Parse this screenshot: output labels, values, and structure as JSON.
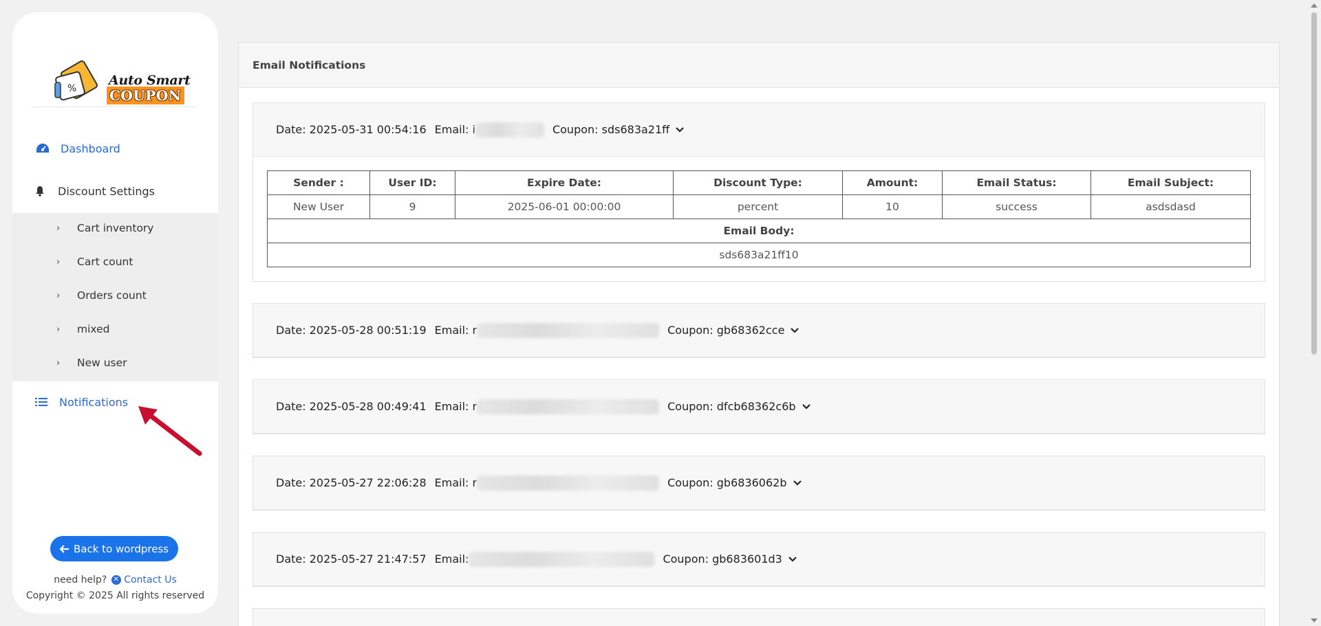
{
  "logo": {
    "line1": "Auto Smart",
    "line2": "COUPON"
  },
  "nav": {
    "dashboard": "Dashboard",
    "discount_settings": "Discount Settings",
    "submenu": [
      "Cart inventory",
      "Cart count",
      "Orders count",
      "mixed",
      "New user"
    ],
    "notifications": "Notifications"
  },
  "footer": {
    "back_button": "Back to wordpress",
    "need_help": "need help?",
    "contact_us": "Contact Us",
    "copyright": "Copyright © 2025 All rights reserved"
  },
  "main": {
    "title": "Email Notifications",
    "notifications": [
      {
        "date": "Date: 2025-05-31 00:54:16",
        "email_label": "Email: i",
        "coupon": "Coupon: sds683a21ff"
      },
      {
        "date": "Date: 2025-05-28 00:51:19",
        "email_label": "Email: r",
        "coupon": "Coupon: gb68362cce"
      },
      {
        "date": "Date: 2025-05-28 00:49:41",
        "email_label": "Email: r",
        "coupon": "Coupon: dfcb68362c6b"
      },
      {
        "date": "Date: 2025-05-27 22:06:28",
        "email_label": "Email: r",
        "coupon": "Coupon: gb6836062b"
      },
      {
        "date": "Date: 2025-05-27 21:47:57",
        "email_label": "Email: ",
        "coupon": "Coupon: gb683601d3"
      }
    ],
    "details": {
      "headers": [
        "Sender :",
        "User ID:",
        "Expire Date:",
        "Discount Type:",
        "Amount:",
        "Email Status:",
        "Email Subject:"
      ],
      "row": [
        "New User",
        "9",
        "2025-06-01 00:00:00",
        "percent",
        "10",
        "success",
        "asdsdasd"
      ],
      "body_label": "Email Body:",
      "body_value": "sds683a21ff10"
    }
  },
  "colors": {
    "accent": "#2b6ad6",
    "button": "#1a73e8",
    "arrow": "#c8102e",
    "logo_orange": "#f7931e"
  }
}
